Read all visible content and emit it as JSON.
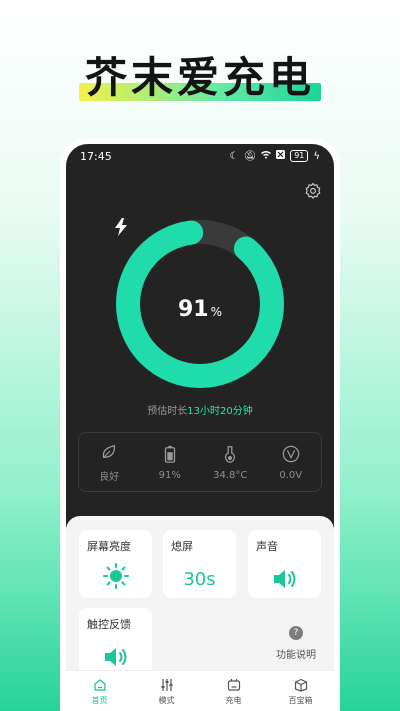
{
  "banner": {
    "title": "芥末爱充电"
  },
  "status_bar": {
    "time": "17:45",
    "battery": "91"
  },
  "charge": {
    "percent": 91,
    "percent_text": "91",
    "unit": "%",
    "estimate_prefix": "预估时长",
    "estimate_value": "13小时20分钟"
  },
  "stats": [
    {
      "icon": "leaf-icon",
      "value": "良好"
    },
    {
      "icon": "battery-icon",
      "value": "91%"
    },
    {
      "icon": "thermometer-icon",
      "value": "34.8°C"
    },
    {
      "icon": "voltage-icon",
      "value": "0.0V"
    }
  ],
  "cards": {
    "brightness": {
      "title": "屏幕亮度"
    },
    "screen_off": {
      "title": "熄屏",
      "value": "30s"
    },
    "sound": {
      "title": "声音"
    },
    "haptics": {
      "title": "触控反馈"
    },
    "help": {
      "label": "功能说明",
      "icon_text": "?"
    }
  },
  "tabs": [
    {
      "label": "首页",
      "active": true
    },
    {
      "label": "模式",
      "active": false
    },
    {
      "label": "充电",
      "active": false
    },
    {
      "label": "百宝箱",
      "active": false
    }
  ],
  "colors": {
    "accent": "#1fdcaa",
    "ring_track": "#3a3a3a",
    "banner_gradient_start": "#f5f14a",
    "banner_gradient_end": "#1bd49a"
  }
}
